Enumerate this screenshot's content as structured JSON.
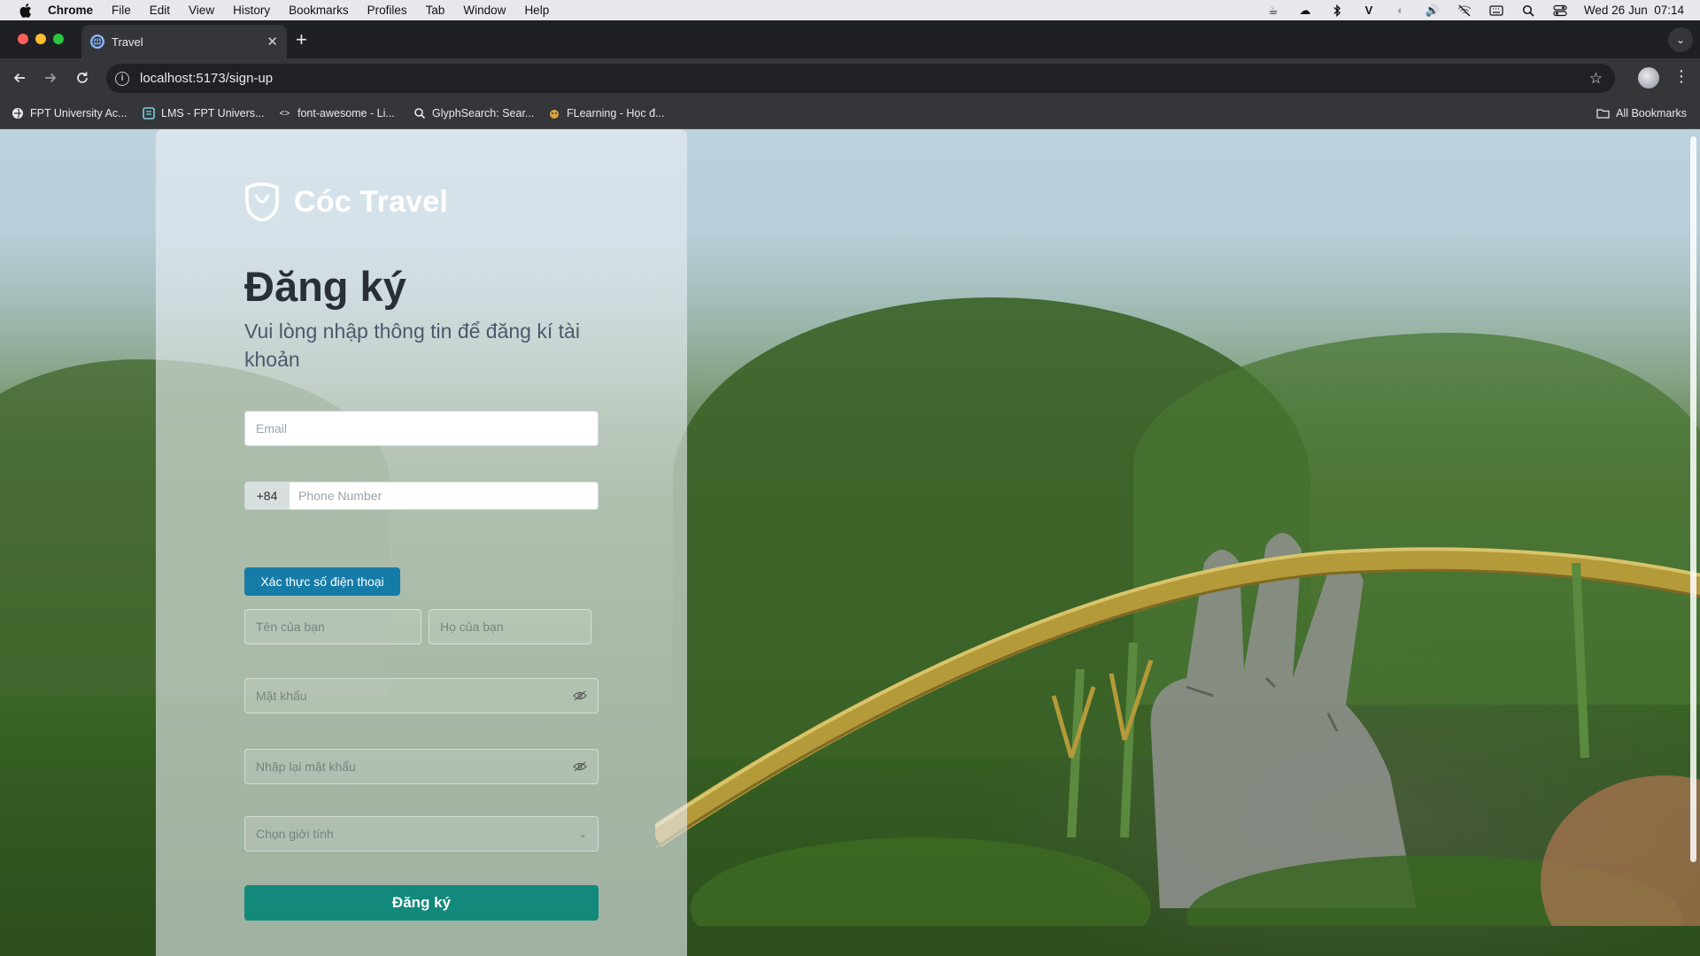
{
  "menubar": {
    "app_name": "Chrome",
    "items": [
      "File",
      "Edit",
      "View",
      "History",
      "Bookmarks",
      "Profiles",
      "Tab",
      "Window",
      "Help"
    ],
    "clock": "Wed 26 Jun  07:14"
  },
  "browser": {
    "tab_title": "Travel",
    "url": "localhost:5173/sign-up",
    "bookmarks": [
      "FPT University Ac...",
      "LMS - FPT Univers...",
      "font-awesome - Li...",
      "GlyphSearch: Sear...",
      "FLearning - Học đ..."
    ],
    "all_bookmarks": "All Bookmarks"
  },
  "page": {
    "brand": "Cóc Travel",
    "title": "Đăng ký",
    "subtitle": "Vui lòng nhập thông tin để đăng kí tài khoản",
    "email_placeholder": "Email",
    "phone_prefix": "+84",
    "phone_placeholder": "Phone Number",
    "verify_button": "Xác thực số điện thoại",
    "first_name_placeholder": "Tên của bạn",
    "last_name_placeholder": "Họ của bạn",
    "password_placeholder": "Mật khẩu",
    "confirm_password_placeholder": "Nhập lại mật khẩu",
    "gender_placeholder": "Chọn giới tính",
    "submit_button": "Đăng ký"
  },
  "colors": {
    "brand_teal": "#12897b",
    "verify_blue": "#157ca8"
  }
}
